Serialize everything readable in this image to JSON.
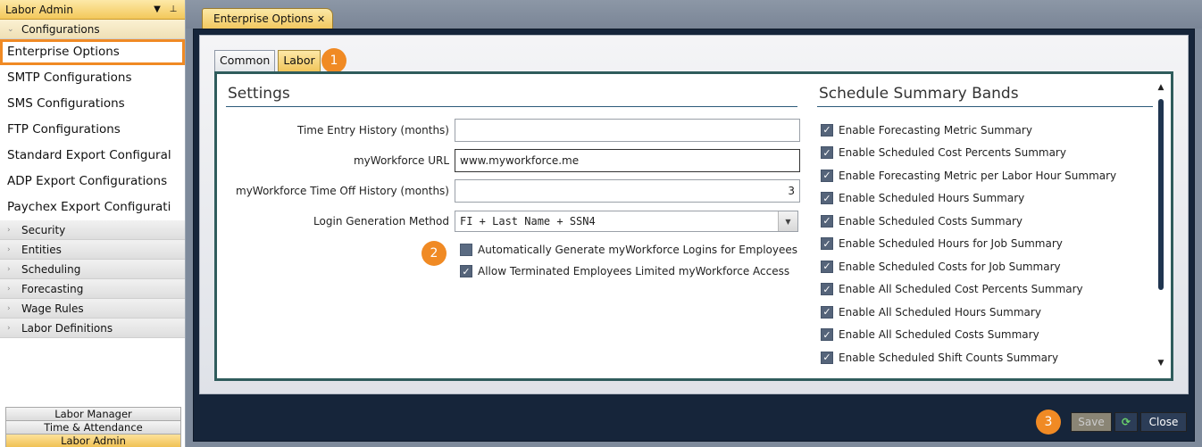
{
  "sidebar": {
    "title": "Labor Admin",
    "dropdown_icon": "caret-down-icon",
    "pin_icon": "pin-icon",
    "configurations_label": "Configurations",
    "config_items": [
      "Enterprise Options",
      "SMTP Configurations",
      "SMS Configurations",
      "FTP Configurations",
      "Standard Export Configural",
      "ADP Export Configurations",
      "Paychex Export Configurati"
    ],
    "groups": [
      "Security",
      "Entities",
      "Scheduling",
      "Forecasting",
      "Wage Rules",
      "Labor Definitions"
    ],
    "footer_buttons": [
      "Labor Manager",
      "Time & Attendance",
      "Labor Admin"
    ]
  },
  "doc_tab": {
    "label": "Enterprise Options",
    "close": "✕"
  },
  "inner_tabs": [
    "Common",
    "Labor"
  ],
  "badges": [
    "1",
    "2",
    "3"
  ],
  "settings": {
    "title": "Settings",
    "time_entry_label": "Time Entry History (months)",
    "time_entry_value": "",
    "url_label": "myWorkforce URL",
    "url_value": "www.myworkforce.me",
    "timeoff_label": "myWorkforce Time Off History (months)",
    "timeoff_value": "3",
    "login_label": "Login Generation Method",
    "login_value": "FI + Last Name + SSN4",
    "auto_generate_label": "Automatically Generate myWorkforce Logins for Employees",
    "auto_generate_checked": false,
    "terminated_label": "Allow Terminated Employees Limited myWorkforce Access",
    "terminated_checked": true
  },
  "bands": {
    "title": "Schedule Summary Bands",
    "items": [
      "Enable Forecasting Metric Summary",
      "Enable Scheduled Cost Percents Summary",
      "Enable Forecasting Metric per Labor Hour Summary",
      "Enable Scheduled Hours Summary",
      "Enable Scheduled Costs Summary",
      "Enable Scheduled Hours for Job Summary",
      "Enable Scheduled Costs for Job Summary",
      "Enable All Scheduled Cost Percents Summary",
      "Enable All Scheduled Hours Summary",
      "Enable All Scheduled Costs Summary",
      "Enable Scheduled Shift Counts Summary"
    ]
  },
  "buttons": {
    "save": "Save",
    "close": "Close",
    "refresh_icon": "refresh-icon"
  },
  "colors": {
    "accent": "#f08a24",
    "tab_gold": "#f2c860",
    "frame_dark": "#16253a"
  }
}
